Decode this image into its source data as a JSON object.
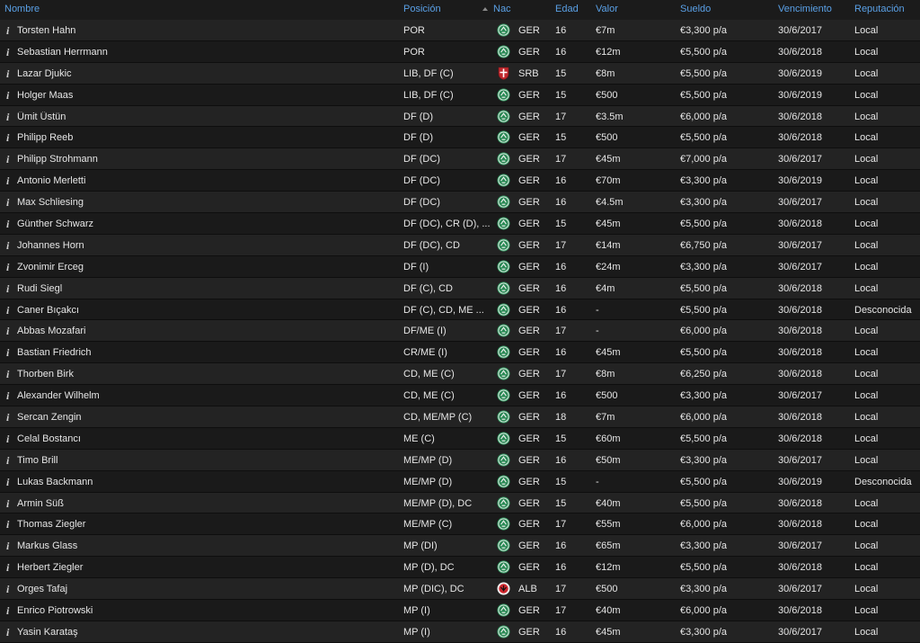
{
  "header": {
    "name": "Nombre",
    "position": "Posición",
    "nat": "Nac",
    "age": "Edad",
    "value": "Valor",
    "wage": "Sueldo",
    "expiry": "Vencimiento",
    "reputation": "Reputación"
  },
  "info_glyph": "i",
  "icons": {
    "sort": "sort-ascending-icon",
    "info": "info-icon",
    "flags": {
      "GER": "germany-federation-badge-icon",
      "SRB": "serbia-federation-badge-icon",
      "ALB": "albania-federation-badge-icon"
    }
  },
  "colors": {
    "header_text": "#5aa0e6",
    "row_odd": "#232323",
    "row_even": "#1a1a1a",
    "text": "#e6e6e6"
  },
  "players": [
    {
      "name": "Torsten Hahn",
      "position": "POR",
      "nat": "GER",
      "age": "16",
      "value": "€7m",
      "wage": "€3,300 p/a",
      "expiry": "30/6/2017",
      "reputation": "Local"
    },
    {
      "name": "Sebastian Herrmann",
      "position": "POR",
      "nat": "GER",
      "age": "16",
      "value": "€12m",
      "wage": "€5,500 p/a",
      "expiry": "30/6/2018",
      "reputation": "Local"
    },
    {
      "name": "Lazar Djukic",
      "position": "LIB, DF (C)",
      "nat": "SRB",
      "age": "15",
      "value": "€8m",
      "wage": "€5,500 p/a",
      "expiry": "30/6/2019",
      "reputation": "Local"
    },
    {
      "name": "Holger Maas",
      "position": "LIB, DF (C)",
      "nat": "GER",
      "age": "15",
      "value": "€500",
      "wage": "€5,500 p/a",
      "expiry": "30/6/2019",
      "reputation": "Local"
    },
    {
      "name": "Ümit Üstün",
      "position": "DF (D)",
      "nat": "GER",
      "age": "17",
      "value": "€3.5m",
      "wage": "€6,000 p/a",
      "expiry": "30/6/2018",
      "reputation": "Local"
    },
    {
      "name": "Philipp Reeb",
      "position": "DF (D)",
      "nat": "GER",
      "age": "15",
      "value": "€500",
      "wage": "€5,500 p/a",
      "expiry": "30/6/2018",
      "reputation": "Local"
    },
    {
      "name": "Philipp Strohmann",
      "position": "DF (DC)",
      "nat": "GER",
      "age": "17",
      "value": "€45m",
      "wage": "€7,000 p/a",
      "expiry": "30/6/2017",
      "reputation": "Local"
    },
    {
      "name": "Antonio Merletti",
      "position": "DF (DC)",
      "nat": "GER",
      "age": "16",
      "value": "€70m",
      "wage": "€3,300 p/a",
      "expiry": "30/6/2019",
      "reputation": "Local"
    },
    {
      "name": "Max Schliesing",
      "position": "DF (DC)",
      "nat": "GER",
      "age": "16",
      "value": "€4.5m",
      "wage": "€3,300 p/a",
      "expiry": "30/6/2017",
      "reputation": "Local"
    },
    {
      "name": "Günther Schwarz",
      "position": "DF (DC), CR (D), ...",
      "nat": "GER",
      "age": "15",
      "value": "€45m",
      "wage": "€5,500 p/a",
      "expiry": "30/6/2018",
      "reputation": "Local"
    },
    {
      "name": "Johannes Horn",
      "position": "DF (DC), CD",
      "nat": "GER",
      "age": "17",
      "value": "€14m",
      "wage": "€6,750 p/a",
      "expiry": "30/6/2017",
      "reputation": "Local"
    },
    {
      "name": "Zvonimir Erceg",
      "position": "DF (I)",
      "nat": "GER",
      "age": "16",
      "value": "€24m",
      "wage": "€3,300 p/a",
      "expiry": "30/6/2017",
      "reputation": "Local"
    },
    {
      "name": "Rudi Siegl",
      "position": "DF (C), CD",
      "nat": "GER",
      "age": "16",
      "value": "€4m",
      "wage": "€5,500 p/a",
      "expiry": "30/6/2018",
      "reputation": "Local"
    },
    {
      "name": "Caner Bıçakcı",
      "position": "DF (C), CD, ME ...",
      "nat": "GER",
      "age": "16",
      "value": "-",
      "wage": "€5,500 p/a",
      "expiry": "30/6/2018",
      "reputation": "Desconocida"
    },
    {
      "name": "Abbas Mozafari",
      "position": "DF/ME (I)",
      "nat": "GER",
      "age": "17",
      "value": "-",
      "wage": "€6,000 p/a",
      "expiry": "30/6/2018",
      "reputation": "Local"
    },
    {
      "name": "Bastian Friedrich",
      "position": "CR/ME (I)",
      "nat": "GER",
      "age": "16",
      "value": "€45m",
      "wage": "€5,500 p/a",
      "expiry": "30/6/2018",
      "reputation": "Local"
    },
    {
      "name": "Thorben Birk",
      "position": "CD, ME (C)",
      "nat": "GER",
      "age": "17",
      "value": "€8m",
      "wage": "€6,250 p/a",
      "expiry": "30/6/2018",
      "reputation": "Local"
    },
    {
      "name": "Alexander Wilhelm",
      "position": "CD, ME (C)",
      "nat": "GER",
      "age": "16",
      "value": "€500",
      "wage": "€3,300 p/a",
      "expiry": "30/6/2017",
      "reputation": "Local"
    },
    {
      "name": "Sercan Zengin",
      "position": "CD, ME/MP (C)",
      "nat": "GER",
      "age": "18",
      "value": "€7m",
      "wage": "€6,000 p/a",
      "expiry": "30/6/2018",
      "reputation": "Local"
    },
    {
      "name": "Celal Bostancı",
      "position": "ME (C)",
      "nat": "GER",
      "age": "15",
      "value": "€60m",
      "wage": "€5,500 p/a",
      "expiry": "30/6/2018",
      "reputation": "Local"
    },
    {
      "name": "Timo Brill",
      "position": "ME/MP (D)",
      "nat": "GER",
      "age": "16",
      "value": "€50m",
      "wage": "€3,300 p/a",
      "expiry": "30/6/2017",
      "reputation": "Local"
    },
    {
      "name": "Lukas Backmann",
      "position": "ME/MP (D)",
      "nat": "GER",
      "age": "15",
      "value": "-",
      "wage": "€5,500 p/a",
      "expiry": "30/6/2019",
      "reputation": "Desconocida"
    },
    {
      "name": "Armin Süß",
      "position": "ME/MP (D), DC",
      "nat": "GER",
      "age": "15",
      "value": "€40m",
      "wage": "€5,500 p/a",
      "expiry": "30/6/2018",
      "reputation": "Local"
    },
    {
      "name": "Thomas Ziegler",
      "position": "ME/MP (C)",
      "nat": "GER",
      "age": "17",
      "value": "€55m",
      "wage": "€6,000 p/a",
      "expiry": "30/6/2018",
      "reputation": "Local"
    },
    {
      "name": "Markus Glass",
      "position": "MP (DI)",
      "nat": "GER",
      "age": "16",
      "value": "€65m",
      "wage": "€3,300 p/a",
      "expiry": "30/6/2017",
      "reputation": "Local"
    },
    {
      "name": "Herbert Ziegler",
      "position": "MP (D), DC",
      "nat": "GER",
      "age": "16",
      "value": "€12m",
      "wage": "€5,500 p/a",
      "expiry": "30/6/2018",
      "reputation": "Local"
    },
    {
      "name": "Orges Tafaj",
      "position": "MP (DIC), DC",
      "nat": "ALB",
      "age": "17",
      "value": "€500",
      "wage": "€3,300 p/a",
      "expiry": "30/6/2017",
      "reputation": "Local"
    },
    {
      "name": "Enrico Piotrowski",
      "position": "MP (I)",
      "nat": "GER",
      "age": "17",
      "value": "€40m",
      "wage": "€6,000 p/a",
      "expiry": "30/6/2018",
      "reputation": "Local"
    },
    {
      "name": "Yasin Karataş",
      "position": "MP (I)",
      "nat": "GER",
      "age": "16",
      "value": "€45m",
      "wage": "€3,300 p/a",
      "expiry": "30/6/2017",
      "reputation": "Local"
    }
  ]
}
